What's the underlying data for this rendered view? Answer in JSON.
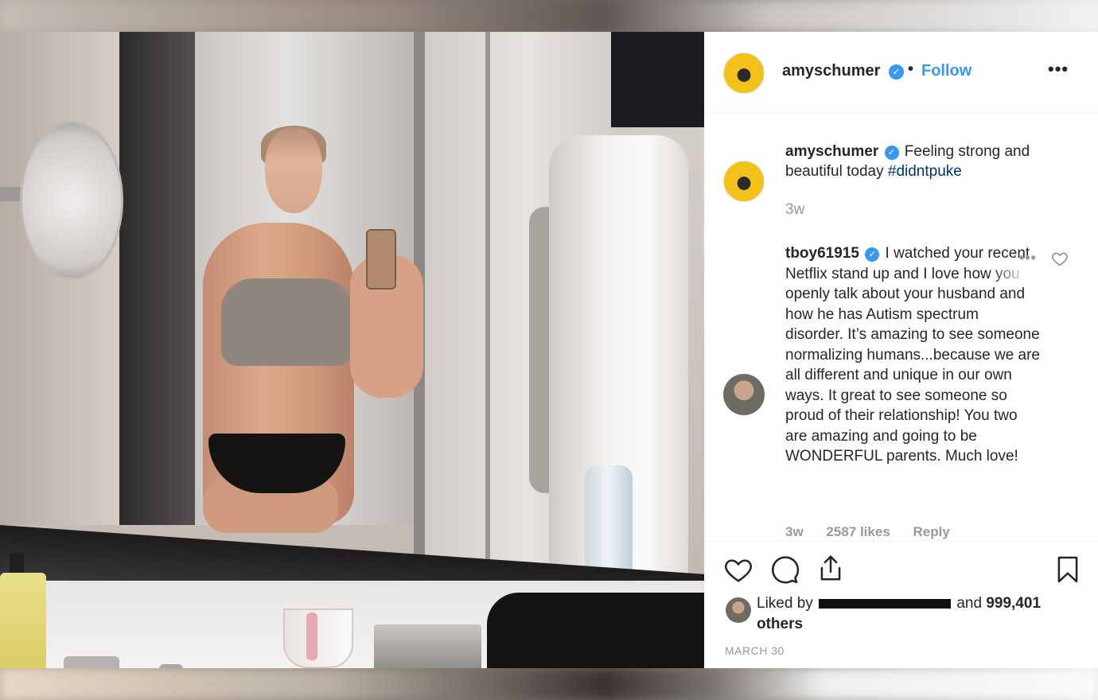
{
  "post": {
    "author": "amyschumer",
    "follow_label": "Follow",
    "separator": "•",
    "more_label": "•••",
    "verified_mark": "✓"
  },
  "caption": {
    "username": "amyschumer",
    "text": "Feeling strong and beautiful today",
    "hashtag": "#didntpuke",
    "time": "3w"
  },
  "comment": {
    "username": "tboy61915",
    "text": "I watched your recent Netflix stand up and I love how you openly talk about your husband and how he has Autism spectrum disorder. It’s amazing to see someone normalizing humans...because we are all different and unique in our own ways. It great to see someone so proud of their relationship! You two are amazing and going to be WONDERFUL parents. Much love!",
    "time": "3w",
    "likes": "2587 likes",
    "reply": "Reply",
    "more_label": "•••"
  },
  "likes": {
    "prefix": "Liked by",
    "joiner": "and",
    "count": "999,401 others"
  },
  "date": "MARCH 30",
  "icons": [
    "heart-icon",
    "comment-icon",
    "share-icon",
    "bookmark-icon",
    "verified-icon",
    "more-icon"
  ],
  "colors": {
    "link_blue": "#3897f0",
    "hashtag": "#003569",
    "muted": "#999999",
    "text": "#262626"
  }
}
